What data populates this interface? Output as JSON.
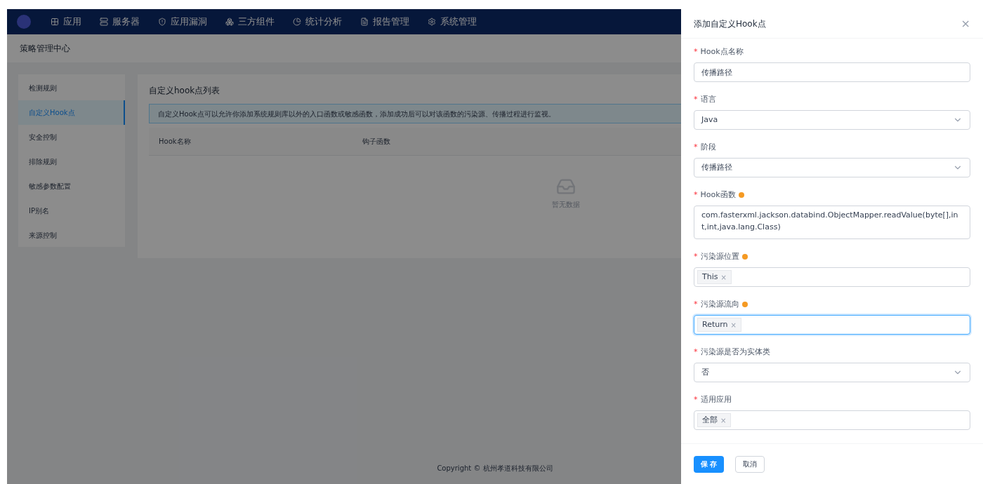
{
  "nav": {
    "items": [
      {
        "label": "应用"
      },
      {
        "label": "服务器"
      },
      {
        "label": "应用漏洞"
      },
      {
        "label": "三方组件"
      },
      {
        "label": "统计分析"
      },
      {
        "label": "报告管理"
      },
      {
        "label": "系统管理"
      }
    ]
  },
  "page_title": "策略管理中心",
  "sidebar": {
    "items": [
      {
        "label": "检测规则",
        "selected": false
      },
      {
        "label": "自定义Hook点",
        "selected": true
      },
      {
        "label": "安全控制",
        "selected": false
      },
      {
        "label": "排除规则",
        "selected": false
      },
      {
        "label": "敏感参数配置",
        "selected": false
      },
      {
        "label": "IP别名",
        "selected": false
      },
      {
        "label": "来源控制",
        "selected": false
      }
    ]
  },
  "content": {
    "title": "自定义hook点列表",
    "alert": "自定义Hook点可以允许你添加系统规则库以外的入口函数或敏感函数，添加成功后可以对该函数的污染源、传播过程进行监视。",
    "table": {
      "columns": [
        "Hook名称",
        "钩子函数"
      ],
      "empty_text": "暂无数据"
    }
  },
  "footer": "Copyright © 杭州孝道科技有限公司",
  "drawer": {
    "title": "添加自定义Hook点",
    "close": "×",
    "fields": [
      {
        "required_mark": "*",
        "label": "Hook点名称",
        "kind": "input",
        "value": "传播路径",
        "info": false,
        "focused": false
      },
      {
        "required_mark": "*",
        "label": "语言",
        "kind": "select",
        "value": "Java",
        "info": false,
        "focused": false
      },
      {
        "required_mark": "*",
        "label": "阶段",
        "kind": "select",
        "value": "传播路径",
        "info": false,
        "focused": false
      },
      {
        "required_mark": "*",
        "label": "Hook函数",
        "kind": "textarea",
        "value": "com.fasterxml.jackson.databind.ObjectMapper.readValue(byte[],int,int,java.lang.Class)",
        "info": true,
        "focused": false
      },
      {
        "required_mark": "*",
        "label": "污染源位置",
        "kind": "tags",
        "tags": [
          {
            "label": "This",
            "remove": "×"
          }
        ],
        "info": true,
        "focused": false
      },
      {
        "required_mark": "*",
        "label": "污染源流向",
        "kind": "tags",
        "tags": [
          {
            "label": "Return",
            "remove": "×"
          }
        ],
        "info": true,
        "focused": true
      },
      {
        "required_mark": "*",
        "label": "污染源是否为实体类",
        "kind": "select",
        "value": "否",
        "info": false,
        "focused": false
      },
      {
        "required_mark": "*",
        "label": "适用应用",
        "kind": "tags",
        "tags": [
          {
            "label": "全部",
            "remove": "×"
          }
        ],
        "info": false,
        "focused": false
      }
    ],
    "buttons": [
      {
        "label": "保 存",
        "kind": "primary"
      },
      {
        "label": "取消",
        "kind": "default"
      }
    ]
  }
}
